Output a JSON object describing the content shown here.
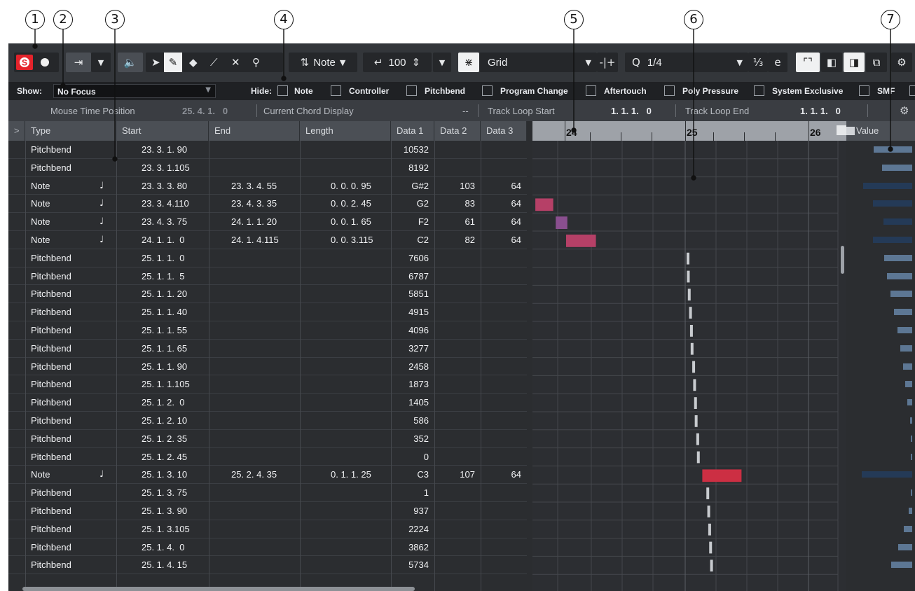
{
  "callouts": [
    "1",
    "2",
    "3",
    "4",
    "5",
    "6",
    "7"
  ],
  "toolbar": {
    "note_label": "Note",
    "velocity_value": "100",
    "snap_mode": "Grid",
    "quantize_value": "1/4",
    "icons": [
      "solo-icon",
      "record-icon",
      "autoscroll-icon",
      "dropdown-icon",
      "acoustic-feedback-icon",
      "object-select-icon",
      "draw-icon",
      "erase-icon",
      "trim-icon",
      "mute-icon",
      "zoom-icon",
      "insert-velocity-icon",
      "snap-icon",
      "snap-to-zero-icon",
      "quantize-icon",
      "global-settings-icon"
    ]
  },
  "filter": {
    "show_label": "Show:",
    "focus_value": "No Focus",
    "hide_label": "Hide:",
    "checkboxes": [
      "Note",
      "Controller",
      "Pitchbend",
      "Program Change",
      "Aftertouch",
      "Poly Pressure",
      "System Exclusive",
      "SMF"
    ]
  },
  "info": {
    "mouse_time_label": "Mouse Time Position",
    "mouse_time_value": "25. 4. 1.   0",
    "chord_label": "Current Chord Display",
    "chord_value": "--",
    "loop_start_label": "Track Loop Start",
    "loop_start_value": "1. 1. 1.   0",
    "loop_end_label": "Track Loop End",
    "loop_end_value": "1. 1. 1.   0"
  },
  "list": {
    "expand_icon": ">",
    "columns": [
      "Type",
      "Start",
      "End",
      "Length",
      "Data 1",
      "Data 2",
      "Data 3"
    ],
    "value_column": "Value",
    "rows": [
      {
        "type": "Pitchbend",
        "start": "23. 3. 1. 90",
        "end": "",
        "length": "",
        "d1": "10532",
        "d2": "",
        "d3": ""
      },
      {
        "type": "Pitchbend",
        "start": "23. 3. 1.105",
        "end": "",
        "length": "",
        "d1": "8192",
        "d2": "",
        "d3": ""
      },
      {
        "type": "Note",
        "start": "23. 3. 3. 80",
        "end": "23. 3. 4. 55",
        "length": "0. 0. 0. 95",
        "d1": "G#2",
        "d2": "103",
        "d3": "64"
      },
      {
        "type": "Note",
        "start": "23. 3. 4.110",
        "end": "23. 4. 3. 35",
        "length": "0. 0. 2. 45",
        "d1": "G2",
        "d2": "83",
        "d3": "64"
      },
      {
        "type": "Note",
        "start": "23. 4. 3. 75",
        "end": "24. 1. 1. 20",
        "length": "0. 0. 1. 65",
        "d1": "F2",
        "d2": "61",
        "d3": "64"
      },
      {
        "type": "Note",
        "start": "24. 1. 1.  0",
        "end": "24. 1. 4.115",
        "length": "0. 0. 3.115",
        "d1": "C2",
        "d2": "82",
        "d3": "64"
      },
      {
        "type": "Pitchbend",
        "start": "25. 1. 1.  0",
        "end": "",
        "length": "",
        "d1": "7606",
        "d2": "",
        "d3": ""
      },
      {
        "type": "Pitchbend",
        "start": "25. 1. 1.  5",
        "end": "",
        "length": "",
        "d1": "6787",
        "d2": "",
        "d3": ""
      },
      {
        "type": "Pitchbend",
        "start": "25. 1. 1. 20",
        "end": "",
        "length": "",
        "d1": "5851",
        "d2": "",
        "d3": ""
      },
      {
        "type": "Pitchbend",
        "start": "25. 1. 1. 40",
        "end": "",
        "length": "",
        "d1": "4915",
        "d2": "",
        "d3": ""
      },
      {
        "type": "Pitchbend",
        "start": "25. 1. 1. 55",
        "end": "",
        "length": "",
        "d1": "4096",
        "d2": "",
        "d3": ""
      },
      {
        "type": "Pitchbend",
        "start": "25. 1. 1. 65",
        "end": "",
        "length": "",
        "d1": "3277",
        "d2": "",
        "d3": ""
      },
      {
        "type": "Pitchbend",
        "start": "25. 1. 1. 90",
        "end": "",
        "length": "",
        "d1": "2458",
        "d2": "",
        "d3": ""
      },
      {
        "type": "Pitchbend",
        "start": "25. 1. 1.105",
        "end": "",
        "length": "",
        "d1": "1873",
        "d2": "",
        "d3": ""
      },
      {
        "type": "Pitchbend",
        "start": "25. 1. 2.  0",
        "end": "",
        "length": "",
        "d1": "1405",
        "d2": "",
        "d3": ""
      },
      {
        "type": "Pitchbend",
        "start": "25. 1. 2. 10",
        "end": "",
        "length": "",
        "d1": "586",
        "d2": "",
        "d3": ""
      },
      {
        "type": "Pitchbend",
        "start": "25. 1. 2. 35",
        "end": "",
        "length": "",
        "d1": "352",
        "d2": "",
        "d3": ""
      },
      {
        "type": "Pitchbend",
        "start": "25. 1. 2. 45",
        "end": "",
        "length": "",
        "d1": "0",
        "d2": "",
        "d3": ""
      },
      {
        "type": "Note",
        "start": "25. 1. 3. 10",
        "end": "25. 2. 4. 35",
        "length": "0. 1. 1. 25",
        "d1": "C3",
        "d2": "107",
        "d3": "64"
      },
      {
        "type": "Pitchbend",
        "start": "25. 1. 3. 75",
        "end": "",
        "length": "",
        "d1": "1",
        "d2": "",
        "d3": ""
      },
      {
        "type": "Pitchbend",
        "start": "25. 1. 3. 90",
        "end": "",
        "length": "",
        "d1": "937",
        "d2": "",
        "d3": ""
      },
      {
        "type": "Pitchbend",
        "start": "25. 1. 3.105",
        "end": "",
        "length": "",
        "d1": "2224",
        "d2": "",
        "d3": ""
      },
      {
        "type": "Pitchbend",
        "start": "25. 1. 4.  0",
        "end": "",
        "length": "",
        "d1": "3862",
        "d2": "",
        "d3": ""
      },
      {
        "type": "Pitchbend",
        "start": "25. 1. 4. 15",
        "end": "",
        "length": "",
        "d1": "5734",
        "d2": "",
        "d3": ""
      }
    ]
  },
  "ruler": {
    "bars": [
      "24",
      "25",
      "26"
    ]
  },
  "colors": {
    "note_velocity_high": "#cc2f43",
    "note_velocity_mid": "#b64067",
    "note_velocity_low": "#8a4f8f",
    "pitchbend_marker": "#c8cbcf",
    "value_bar_positive": "#5d7794",
    "value_bar_negative": "#243a57",
    "solo_red": "#e4232b"
  }
}
